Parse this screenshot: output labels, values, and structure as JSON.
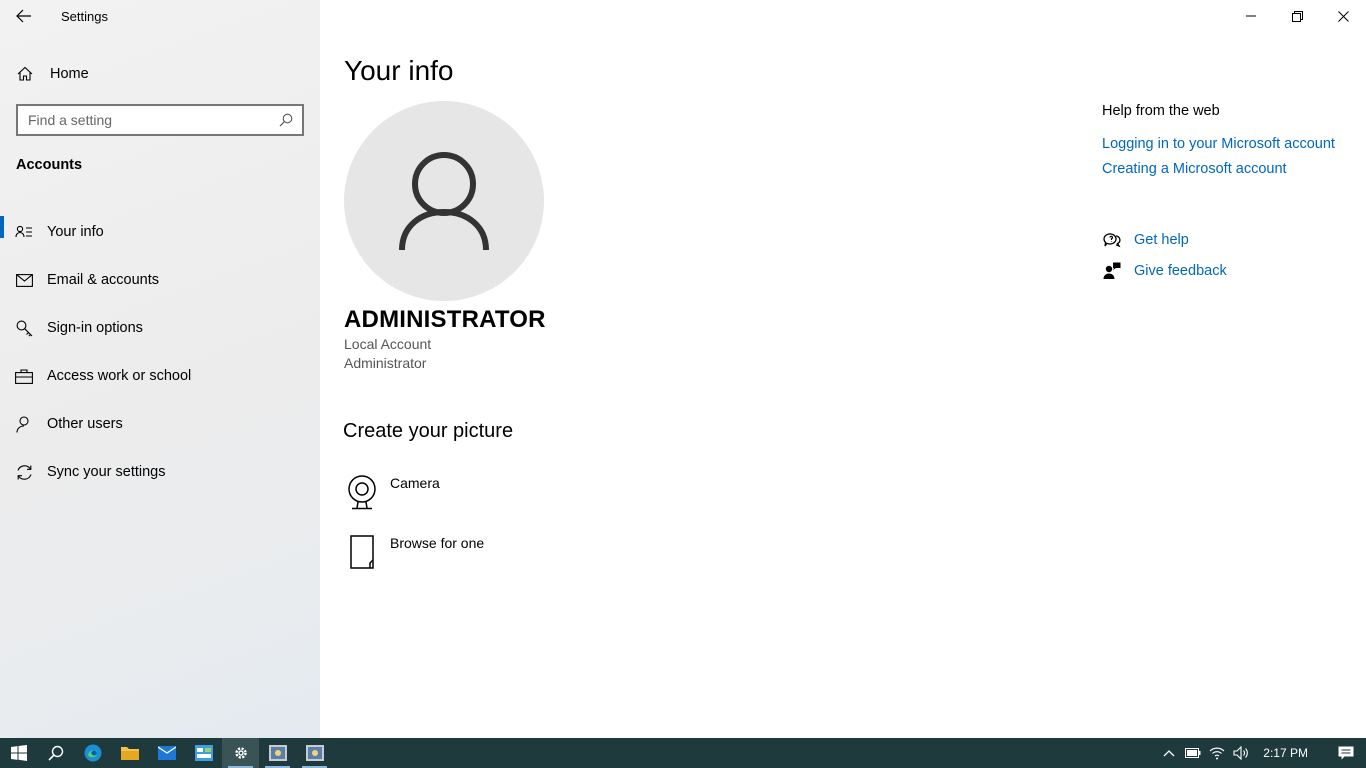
{
  "window": {
    "title": "Settings"
  },
  "sidebar": {
    "home_label": "Home",
    "search_placeholder": "Find a setting",
    "section_title": "Accounts",
    "items": [
      {
        "label": "Your info",
        "icon": "contact-card-icon",
        "active": true
      },
      {
        "label": "Email & accounts",
        "icon": "mail-icon",
        "active": false
      },
      {
        "label": "Sign-in options",
        "icon": "key-icon",
        "active": false
      },
      {
        "label": "Access work or school",
        "icon": "briefcase-icon",
        "active": false
      },
      {
        "label": "Other users",
        "icon": "person-add-icon",
        "active": false
      },
      {
        "label": "Sync your settings",
        "icon": "sync-icon",
        "active": false
      }
    ]
  },
  "main": {
    "title": "Your info",
    "user_name": "ADMINISTRATOR",
    "account_type": "Local Account",
    "account_role": "Administrator",
    "create_title": "Create your picture",
    "camera_label": "Camera",
    "browse_label": "Browse for one"
  },
  "help": {
    "heading": "Help from the web",
    "links": [
      "Logging in to your Microsoft account",
      "Creating a Microsoft account"
    ],
    "get_help": "Get help",
    "give_feedback": "Give feedback"
  },
  "taskbar": {
    "time": "2:17 PM"
  },
  "colors": {
    "accent": "#0067c0",
    "taskbar": "#1f3a3d",
    "avatar_bg": "#e6e6e6"
  }
}
